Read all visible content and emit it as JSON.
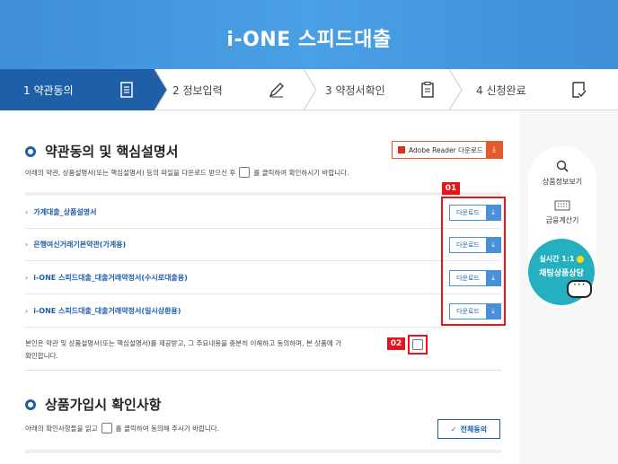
{
  "header": {
    "title": "i-ONE 스피드대출"
  },
  "steps": [
    {
      "label": "1  약관동의",
      "icon": "document-icon"
    },
    {
      "label": "2  정보입력",
      "icon": "pen-icon"
    },
    {
      "label": "3  약정서확인",
      "icon": "clipboard-icon"
    },
    {
      "label": "4  신청완료",
      "icon": "checklist-icon"
    }
  ],
  "section1": {
    "title": "약관동의 및 핵심설명서",
    "desc_before": "아래의 약관, 상품설명서(또는 핵심설명서) 등의 파일을 다운로드 받으신 후",
    "desc_after": "를 클릭하여 확인하시기 바랍니다.",
    "adobe_label": "Adobe Reader 다운로드"
  },
  "documents": [
    {
      "name": "가계대출_상품설명서"
    },
    {
      "name": "은행여신거래기본약관(가계용)"
    },
    {
      "name": "i-ONE 스피드대출_대출거래약정서(수시로대출용)"
    },
    {
      "name": "i-ONE 스피드대출_대출거래약정서(일시상환용)"
    }
  ],
  "download_label": "다운로드",
  "badges": {
    "b1": "01",
    "b2": "02"
  },
  "consent": {
    "line1": "본인은 약관 및 상품설명서(또는 핵심설명서)를 제공받고, 그 주요내용을 충분히 이해하고 동의하며, 본 상품에 가",
    "line2": "확인합니다."
  },
  "section2": {
    "title": "상품가입시 확인사항",
    "desc_before": "아래의 확인사항들을 읽고",
    "desc_after": "를 클릭하여 동의해 주시기 바랍니다.",
    "all_agree_label": "전체동의"
  },
  "side": {
    "product_info": "상품정보보기",
    "calculator": "금융계산기",
    "chat_line1": "실시간 1:1",
    "chat_line2": "채팅상품상담"
  }
}
